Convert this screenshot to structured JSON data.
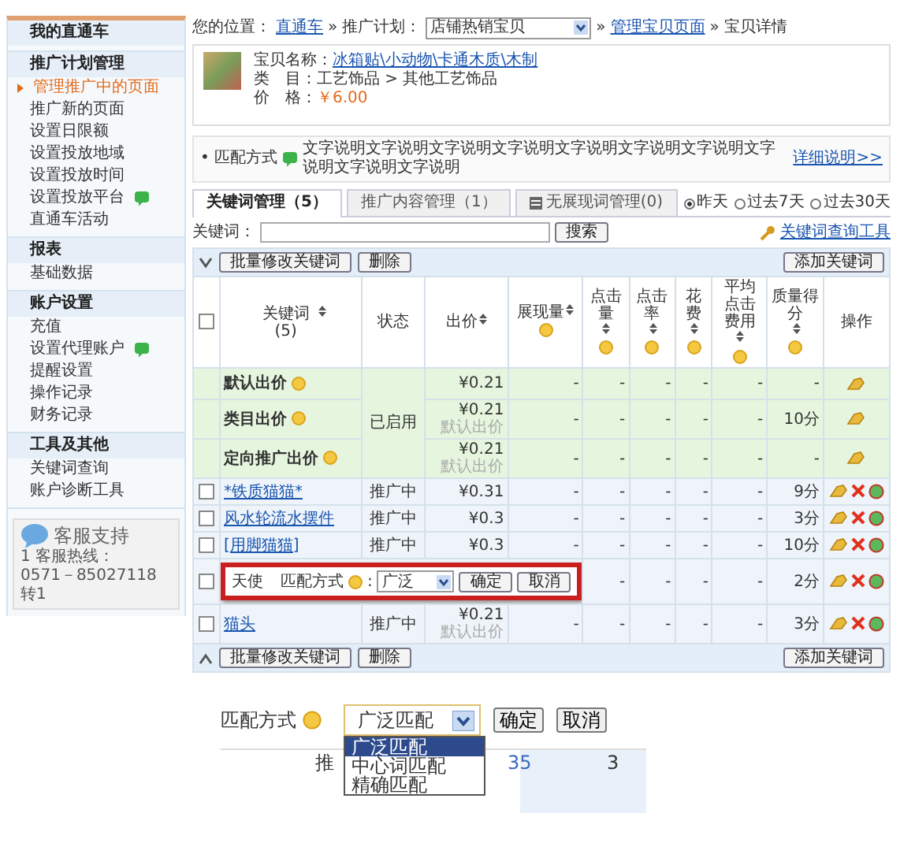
{
  "sidebar": {
    "groups": [
      {
        "title": "我的直通车"
      },
      {
        "title": "推广计划管理",
        "items": [
          {
            "label": "管理推广中的页面",
            "selected": true,
            "new": false
          },
          {
            "label": "推广新的页面",
            "selected": false,
            "new": false
          },
          {
            "label": "设置日限额",
            "selected": false,
            "new": false
          },
          {
            "label": "设置投放地域",
            "selected": false,
            "new": false
          },
          {
            "label": "设置投放时间",
            "selected": false,
            "new": false
          },
          {
            "label": "设置投放平台",
            "selected": false,
            "new": true
          },
          {
            "label": "直通车活动",
            "selected": false,
            "new": false
          }
        ]
      },
      {
        "title": "报表",
        "items": [
          {
            "label": "基础数据",
            "selected": false,
            "new": false
          }
        ]
      },
      {
        "title": "账户设置",
        "items": [
          {
            "label": "充值",
            "selected": false,
            "new": false
          },
          {
            "label": "设置代理账户",
            "selected": false,
            "new": true
          },
          {
            "label": "提醒设置",
            "selected": false,
            "new": false
          },
          {
            "label": "操作记录",
            "selected": false,
            "new": false
          },
          {
            "label": "财务记录",
            "selected": false,
            "new": false
          }
        ]
      },
      {
        "title": "工具及其他",
        "items": [
          {
            "label": "关键词查询",
            "selected": false,
            "new": false
          },
          {
            "label": "账户诊断工具",
            "selected": false,
            "new": false
          }
        ]
      }
    ],
    "support": {
      "title": "客服支持",
      "lines": [
        "1 客服热线：",
        "0571－85027118转1"
      ]
    }
  },
  "breadcrumb": [
    {
      "kind": "text",
      "text": "您的位置："
    },
    {
      "kind": "link",
      "text": "直通车"
    },
    {
      "kind": "sep",
      "text": "»"
    },
    {
      "kind": "text",
      "text": "推广计划："
    },
    {
      "kind": "select",
      "text": "店铺热销宝贝"
    },
    {
      "kind": "sep",
      "text": "»"
    },
    {
      "kind": "link",
      "text": "管理宝贝页面"
    },
    {
      "kind": "sep",
      "text": "»"
    },
    {
      "kind": "text",
      "text": "宝贝详情"
    }
  ],
  "product": {
    "fields": [
      {
        "label": "宝贝名称：",
        "value": "冰箱贴\\小动物\\卡通木质\\木制",
        "kind": "link"
      },
      {
        "label": "类　目：",
        "value": "工艺饰品 > 其他工艺饰品",
        "kind": "plain"
      },
      {
        "label": "价　格：",
        "value": "￥6.00",
        "kind": "price"
      }
    ]
  },
  "tip": {
    "bullet": "•",
    "label": "匹配方式",
    "text": "文字说明文字说明文字说明文字说明文字说明文字说明文字说明文字说明文字说明文字说明",
    "link": "详细说明>>"
  },
  "tabs": [
    {
      "label": "关键词管理（5）",
      "selected": true
    },
    {
      "label": "推广内容管理（1）",
      "selected": false
    },
    {
      "label": "无展现词管理(0)",
      "selected": false
    }
  ],
  "periods": [
    {
      "label": "昨天",
      "selected": true
    },
    {
      "label": "过去7天",
      "selected": false
    },
    {
      "label": "过去30天",
      "selected": false
    }
  ],
  "search": {
    "label": "关键词：",
    "button": "搜索",
    "tool_link": "关键词查询工具"
  },
  "toolbar_top": {
    "batch": "批量修改关键词",
    "delete": "删除",
    "add": "添加关键词"
  },
  "toolbar_bottom": {
    "batch": "批量修改关键词",
    "delete": "删除",
    "add": "添加关键词"
  },
  "table": {
    "select_all_checked": false,
    "columns": [
      {
        "label": "关键词(5)",
        "sortable": true,
        "help": false
      },
      {
        "label": "状态",
        "sortable": false,
        "help": false
      },
      {
        "label": "出价",
        "sortable": true,
        "help": false
      },
      {
        "label": "展现量",
        "sortable": true,
        "help": true
      },
      {
        "label": "点击量",
        "sortable": true,
        "help": true
      },
      {
        "label": "点击率",
        "sortable": true,
        "help": true
      },
      {
        "label": "花费",
        "sortable": true,
        "help": true
      },
      {
        "label": "平均点击费用",
        "sortable": true,
        "help": true
      },
      {
        "label": "质量得分",
        "sortable": true,
        "help": true
      },
      {
        "label": "操作",
        "sortable": false,
        "help": false
      }
    ],
    "default_status": "已启用",
    "default_rows": [
      {
        "name": "默认出价",
        "bid": "¥0.21",
        "stats": [
          "-",
          "-",
          "-",
          "-",
          "-"
        ],
        "quality": "-"
      },
      {
        "name": "类目出价",
        "bid": "¥0.21",
        "bid_note": "默认出价",
        "stats": [
          "-",
          "-",
          "-",
          "-",
          "-"
        ],
        "quality": "10分"
      },
      {
        "name": "定向推广出价",
        "bid": "¥0.21",
        "bid_note": "默认出价",
        "stats": [
          "-",
          "-",
          "-",
          "-",
          "-"
        ],
        "quality": "-"
      }
    ],
    "rows": [
      {
        "kind": "normal",
        "checked": false,
        "keyword": "*铁质猫猫*",
        "status": "推广中",
        "bid": "¥0.31",
        "stats": [
          "-",
          "-",
          "-",
          "-",
          "-"
        ],
        "quality": "9分"
      },
      {
        "kind": "normal",
        "checked": false,
        "keyword": "风水轮流水摆件",
        "status": "推广中",
        "bid": "¥0.3",
        "stats": [
          "-",
          "-",
          "-",
          "-",
          "-"
        ],
        "quality": "3分"
      },
      {
        "kind": "normal",
        "checked": false,
        "keyword": "[用脚猫猫]",
        "status": "推广中",
        "bid": "¥0.3",
        "stats": [
          "-",
          "-",
          "-",
          "-",
          "-"
        ],
        "quality": "10分"
      },
      {
        "kind": "editing",
        "checked": false,
        "keyword": "天使",
        "match_label": "匹配方式",
        "match_suffix": ":",
        "match_value": "广泛",
        "confirm": "确定",
        "cancel": "取消",
        "stats": [
          "-",
          "-",
          "-",
          "-"
        ],
        "quality": "2分"
      },
      {
        "kind": "normal",
        "checked": false,
        "keyword": "猫头",
        "status": "推广中",
        "bid": "¥0.21",
        "bid_note": "默认出价",
        "stats": [
          "-",
          "-",
          "-",
          "-",
          "-"
        ],
        "quality": "3分"
      }
    ]
  },
  "inset": {
    "label": "匹配方式",
    "value": "广泛匹配",
    "confirm": "确定",
    "cancel": "取消",
    "options": [
      {
        "label": "广泛匹配",
        "selected": true
      },
      {
        "label": "中心词匹配",
        "selected": false
      },
      {
        "label": "精确匹配",
        "selected": false
      }
    ],
    "behind": [
      "推",
      "35",
      "3"
    ]
  }
}
